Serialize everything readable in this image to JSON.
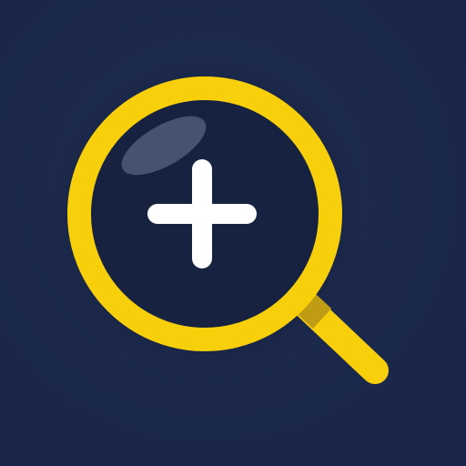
{
  "icon": {
    "name": "zoom-in-icon",
    "glyph": "magnifying-glass-with-plus",
    "colors": {
      "background": "#1a2747",
      "lens_inner": "#16223f",
      "ring": "#f7cf0a",
      "handle_shadow": "#c09c14",
      "plus": "#ffffff",
      "glare": "#46536f"
    }
  }
}
